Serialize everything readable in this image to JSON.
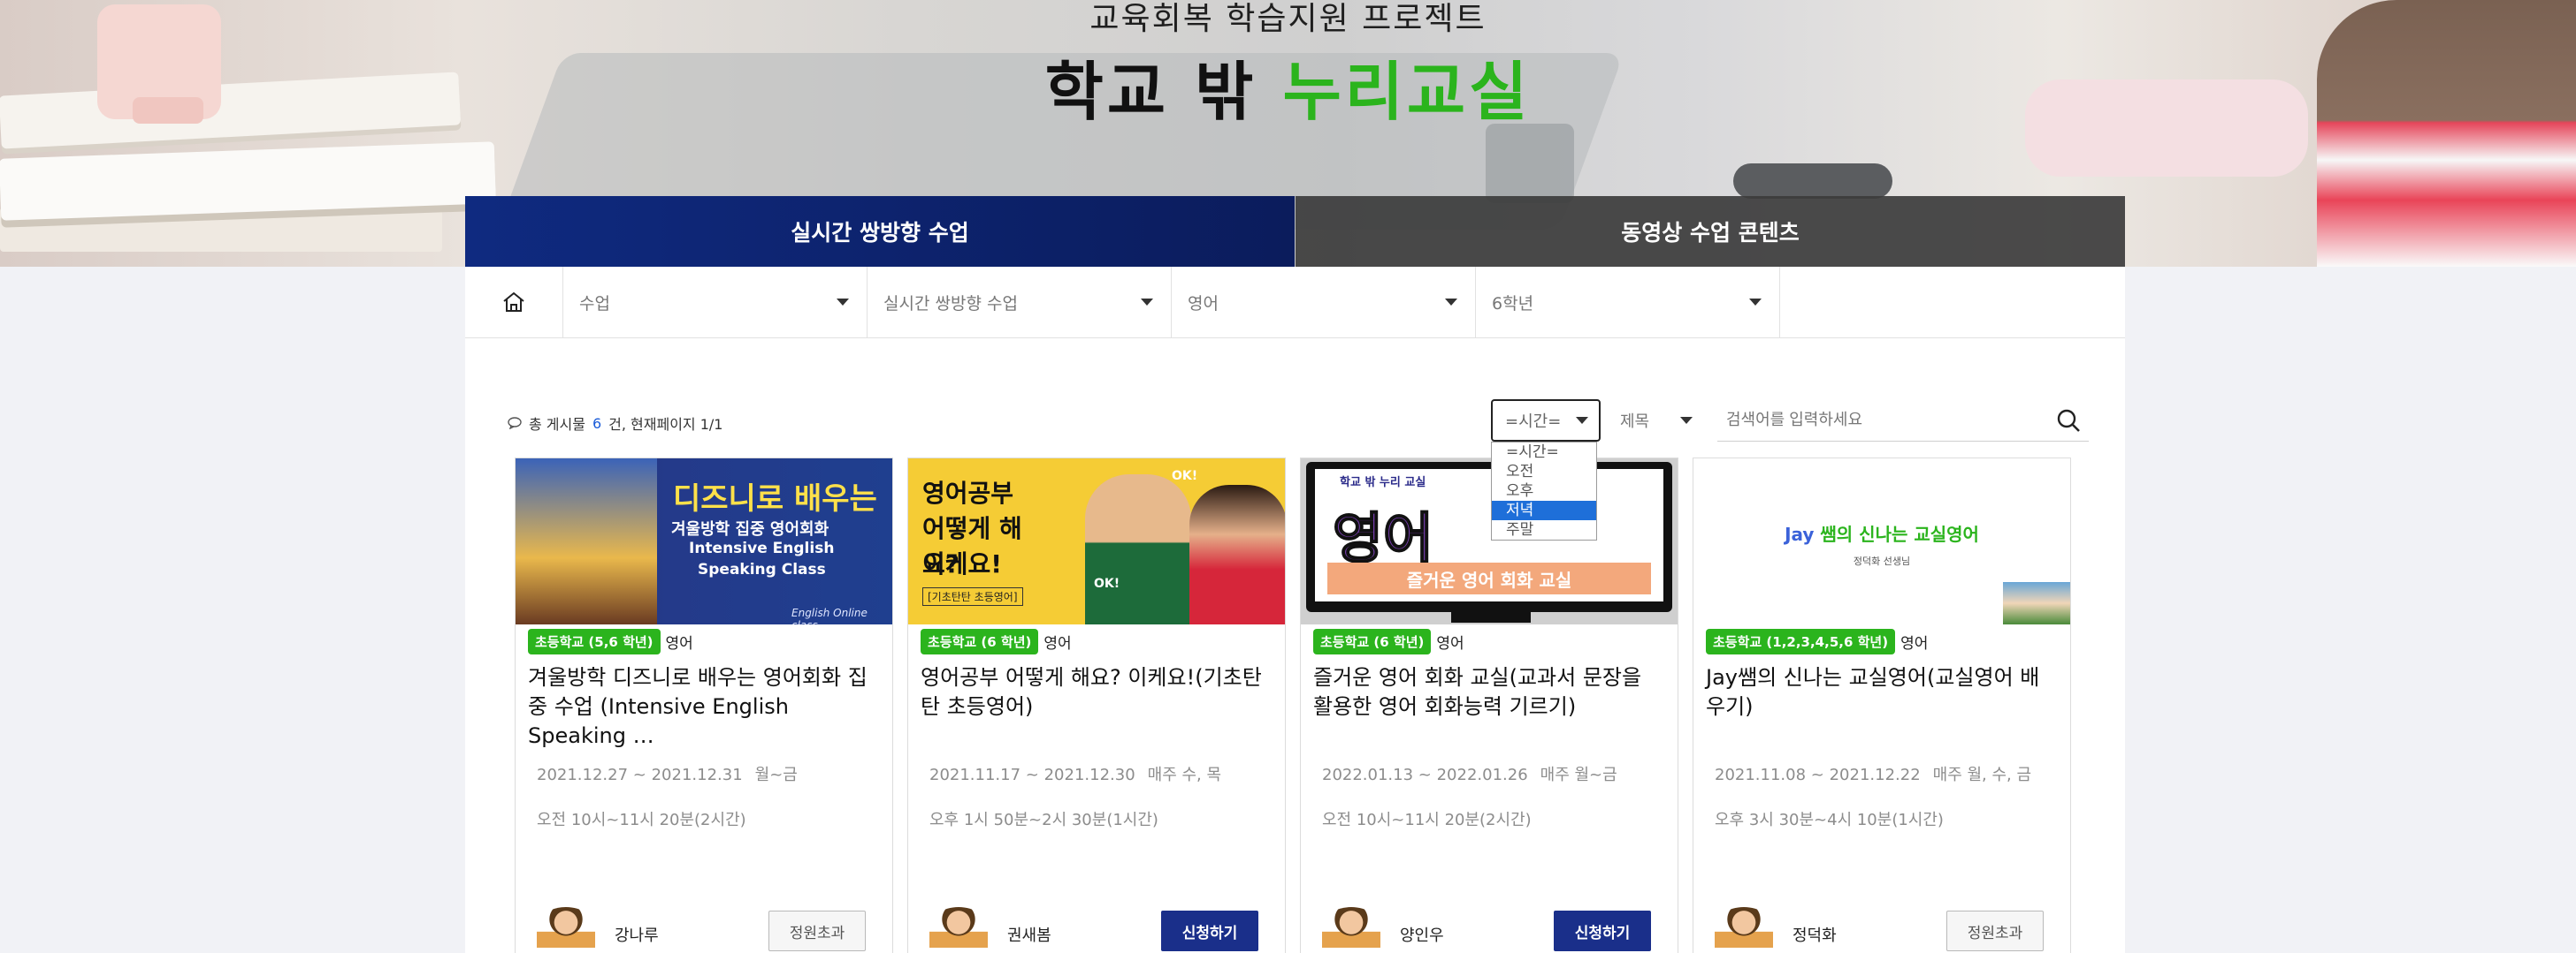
{
  "hero": {
    "subtitle": "교육회복 학습지원 프로젝트",
    "title_black": "학교 밖",
    "title_green": "누리교실"
  },
  "tabs": [
    {
      "label": "실시간 쌍방향 수업",
      "active": true
    },
    {
      "label": "동영상 수업 콘텐츠",
      "active": false
    }
  ],
  "breadcrumb": {
    "home_icon": "home-icon",
    "selects": [
      "수업",
      "실시간 쌍방향 수업",
      "영어",
      "6학년"
    ]
  },
  "list_info": {
    "prefix": "총 게시물",
    "count": "6",
    "suffix": "건, 현재페이지 1/1"
  },
  "filters": {
    "time_selected": "=시간=",
    "time_options": [
      "=시간=",
      "오전",
      "오후",
      "저녁",
      "주말"
    ],
    "time_highlighted": "저녁",
    "field_selected": "제목",
    "search_placeholder": "검색어를 입력하세요"
  },
  "cards": [
    {
      "thumb_lines": [
        "디즈니로 배우는",
        "겨울방학 집중 영어회화",
        "Intensive English",
        "Speaking Class",
        "English Online class"
      ],
      "badge": "초등학교 (5,6 학년)",
      "subject": "영어",
      "title": "겨울방학 디즈니로 배우는 영어회화 집중 수업 (Intensive English Speaking …",
      "period": "2021.12.27 ~ 2021.12.31",
      "days": "월~금",
      "hours": "오전 10시~11시 20분(2시간)",
      "teacher": "강나루",
      "button": "정원초과",
      "button_type": "full"
    },
    {
      "thumb_lines": [
        "영어공부",
        "어떻게 해요?",
        "이케요!",
        "[기초탄탄 초등영어]",
        "OK!",
        "OK!"
      ],
      "badge": "초등학교 (6 학년)",
      "subject": "영어",
      "title": "영어공부 어떻게 해요? 이케요!(기초탄탄 초등영어)",
      "period": "2021.11.17 ~ 2021.12.30",
      "days": "매주 수, 목",
      "hours": "오후 1시 50분~2시 30분(1시간)",
      "teacher": "권새봄",
      "button": "신청하기",
      "button_type": "apply"
    },
    {
      "thumb_lines": [
        "학교 밖 누리 교실",
        "영어",
        "즐거운 영어 회화 교실"
      ],
      "badge": "초등학교 (6 학년)",
      "subject": "영어",
      "title": "즐거운 영어 회화 교실(교과서 문장을 활용한 영어 회화능력 기르기)",
      "period": "2022.01.13 ~ 2022.01.26",
      "days": "매주 월~금",
      "hours": "오전 10시~11시 20분(2시간)",
      "teacher": "양인우",
      "button": "신청하기",
      "button_type": "apply"
    },
    {
      "thumb_lines": [
        "Jay",
        "쌤의",
        "신나는 교실영어",
        "정덕화 선생님"
      ],
      "badge": "초등학교 (1,2,3,4,5,6 학년)",
      "subject": "영어",
      "title": "Jay쌤의 신나는 교실영어(교실영어 배우기)",
      "period": "2021.11.08 ~ 2021.12.22",
      "days": "매주 월, 수, 금",
      "hours": "오후 3시 30분~4시 10분(1시간)",
      "teacher": "정덕화",
      "button": "정원초과",
      "button_type": "full"
    }
  ],
  "colors": {
    "accent_green": "#2bb41d",
    "tab_navy": "#0f2a80",
    "apply_button": "#1a2f8a",
    "link_blue": "#1a5bd8"
  }
}
